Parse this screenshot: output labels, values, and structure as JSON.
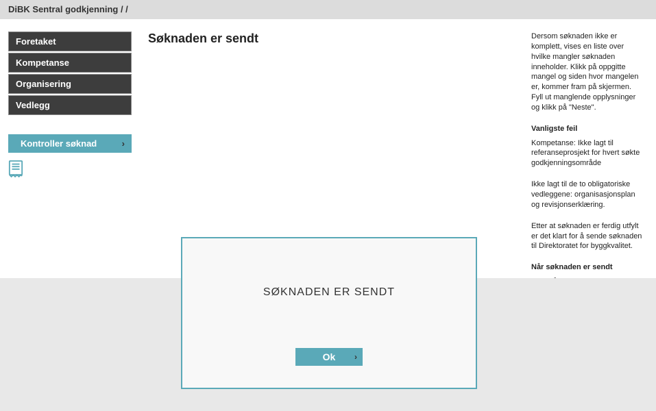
{
  "header": {
    "title": "DiBK Sentral godkjenning / /"
  },
  "sidebar": {
    "items": [
      {
        "label": "Foretaket"
      },
      {
        "label": "Kompetanse"
      },
      {
        "label": "Organisering"
      },
      {
        "label": "Vedlegg"
      }
    ],
    "control_label": "Kontroller søknad"
  },
  "main": {
    "title": "Søknaden er sendt"
  },
  "help": {
    "p1": "Dersom søknaden ikke er komplett, vises en liste over hvilke mangler søknaden inneholder. Klikk på oppgitte mangel og siden hvor mangelen er, kommer fram på skjermen. Fyll ut manglende opplysninger og klikk på \"Neste\".",
    "h1": "Vanligste feil",
    "p2": "Kompetanse: Ikke lagt til referanseprosjekt for hvert søkte godkjenningsområde",
    "p3": "Ikke lagt til de to obligatoriske vedleggene: organisasjonsplan og revisjonserklæring.",
    "p4": "Etter at søknaden er ferdig utfylt er det klart for å sende søknaden til Direktoratet for byggkvalitet.",
    "h2": "Når søknaden er sendt",
    "p5": "Svar på søknad kan ventes innen fire uker. Det mottas per i dag ikke kvittering på sendt søknad."
  },
  "modal": {
    "title": "SØKNADEN ER SENDT",
    "ok_label": "Ok"
  }
}
